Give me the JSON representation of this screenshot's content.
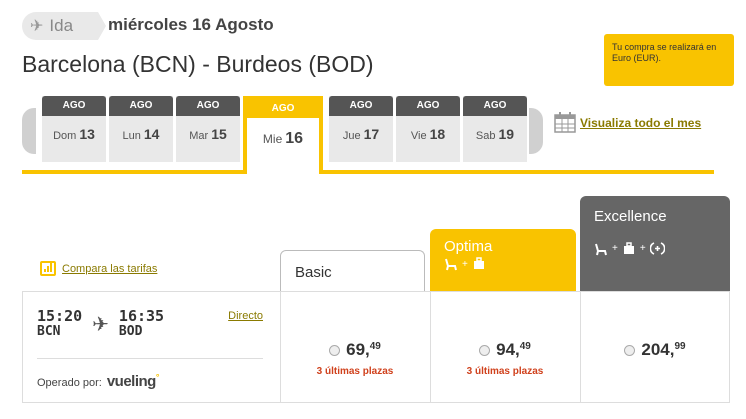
{
  "header": {
    "direction_label": "Ida",
    "date_title": "miércoles 16 Agosto",
    "route": "Barcelona (BCN) - Burdeos (BOD)",
    "currency_note": "Tu compra se realizará en Euro (EUR)."
  },
  "date_strip": {
    "days": [
      {
        "month": "AGO",
        "weekday": "Dom",
        "day": "13"
      },
      {
        "month": "AGO",
        "weekday": "Lun",
        "day": "14"
      },
      {
        "month": "AGO",
        "weekday": "Mar",
        "day": "15"
      },
      {
        "month": "AGO",
        "weekday": "Mie",
        "day": "16"
      },
      {
        "month": "AGO",
        "weekday": "Jue",
        "day": "17"
      },
      {
        "month": "AGO",
        "weekday": "Vie",
        "day": "18"
      },
      {
        "month": "AGO",
        "weekday": "Sab",
        "day": "19"
      }
    ],
    "selected_day": "16",
    "month_link": "Visualiza todo el mes"
  },
  "fares": {
    "compare_link": "Compara las tarifas",
    "basic": "Basic",
    "optima": "Optima",
    "excellence": "Excellence"
  },
  "flight": {
    "departure_time": "15:20",
    "departure_code": "BCN",
    "arrival_time": "16:35",
    "arrival_code": "BOD",
    "stops": "Directo",
    "operated_by": "Operado por:",
    "airline": "vueling",
    "prices": [
      {
        "int": "69,",
        "dec": "49",
        "seats": "3 últimas plazas"
      },
      {
        "int": "94,",
        "dec": "49",
        "seats": "3 últimas plazas"
      },
      {
        "int": "204,",
        "dec": "99",
        "seats": ""
      }
    ]
  },
  "colors": {
    "accent": "#f9c300",
    "dark": "#666666",
    "alert": "#d0411c",
    "link": "#8a7a00"
  }
}
